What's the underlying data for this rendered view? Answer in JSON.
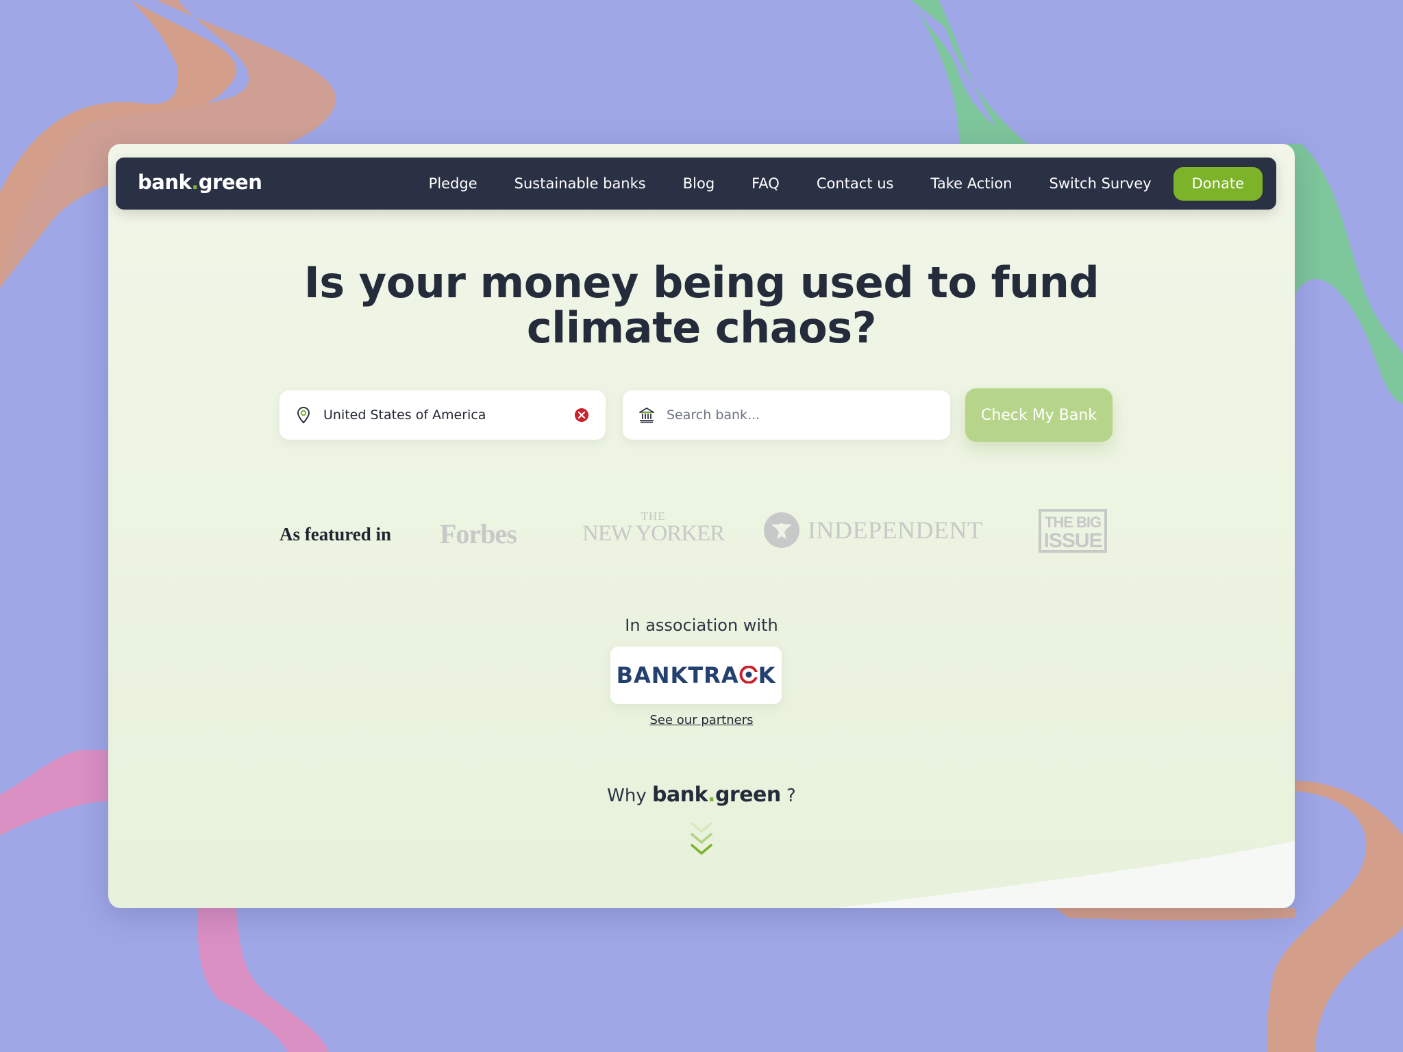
{
  "nav": {
    "logo_text": "bank.green",
    "items": [
      {
        "label": "Pledge"
      },
      {
        "label": "Sustainable banks"
      },
      {
        "label": "Blog"
      },
      {
        "label": "FAQ"
      },
      {
        "label": "Contact us"
      },
      {
        "label": "Take Action"
      },
      {
        "label": "Switch Survey"
      }
    ],
    "donate_label": "Donate"
  },
  "hero": {
    "title_line1": "Is your money being used to fund",
    "title_line2": "climate chaos?"
  },
  "search": {
    "country_value": "United States of America",
    "bank_placeholder": "Search bank...",
    "bank_value": "",
    "submit_label": "Check My Bank",
    "location_icon": "map-pin-icon",
    "bank_icon": "bank-building-icon",
    "clear_icon": "clear-x-icon"
  },
  "featured": {
    "label": "As featured in",
    "outlets": [
      {
        "name": "Forbes"
      },
      {
        "name": "THE NEW YORKER"
      },
      {
        "name": "INDEPENDENT"
      },
      {
        "name": "THE BIG ISSUE"
      }
    ]
  },
  "association": {
    "label": "In association with",
    "partner_name": "BANKTRACK",
    "partners_link": "See our partners"
  },
  "why": {
    "prefix": "Why",
    "logo_text": "bank.green",
    "suffix": "?"
  },
  "colors": {
    "background": "#9ea6e6",
    "navbar": "#2b3144",
    "accent_green": "#7cb329",
    "button_disabled": "#b6d58a",
    "headline": "#242b3b",
    "banktrack_blue": "#24406e",
    "banktrack_red": "#c8232c"
  }
}
